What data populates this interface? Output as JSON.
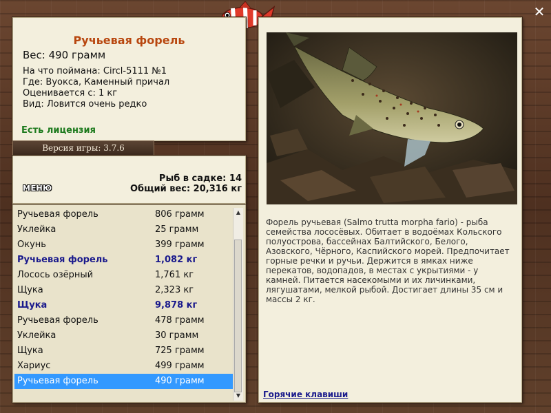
{
  "fish": {
    "name": "Ручьевая форель",
    "weight": "Вес: 490 грамм",
    "caught_with": "На что поймана: Circl-5111 №1",
    "location": "Где: Вуокса, Каменный причал",
    "rated_from": "Оценивается с: 1 кг",
    "kind": "Вид: Ловится очень редко",
    "license": "Есть лицензия"
  },
  "version": "Версия игры: 3.7.6",
  "stats": {
    "menu_label": "МЕНЮ",
    "cage_count": "Рыб в садке: 14",
    "total_weight": "Общий вес: 20,316 кг"
  },
  "catch_list": [
    {
      "name": "Ручьевая форель",
      "weight": "806 грамм",
      "style": ""
    },
    {
      "name": "Уклейка",
      "weight": "25 грамм",
      "style": ""
    },
    {
      "name": "Окунь",
      "weight": "399 грамм",
      "style": ""
    },
    {
      "name": "Ручьевая форель",
      "weight": "1,082 кг",
      "style": "big"
    },
    {
      "name": "Лосось озёрный",
      "weight": "1,761 кг",
      "style": ""
    },
    {
      "name": "Щука",
      "weight": "2,323 кг",
      "style": ""
    },
    {
      "name": "Щука",
      "weight": "9,878 кг",
      "style": "big"
    },
    {
      "name": "Ручьевая форель",
      "weight": "478 грамм",
      "style": ""
    },
    {
      "name": "Уклейка",
      "weight": "30 грамм",
      "style": ""
    },
    {
      "name": "Щука",
      "weight": "725 грамм",
      "style": ""
    },
    {
      "name": "Хариус",
      "weight": "499 грамм",
      "style": ""
    },
    {
      "name": "Ручьевая форель",
      "weight": "490 грамм",
      "style": "selected"
    }
  ],
  "detail": {
    "description": "Форель ручьевая (Salmo trutta morpha fario) - рыба семейства лососёвых. Обитает в водоёмах Кольского полуострова, бассейнах Балтийского, Белого, Азовского, Чёрного, Каспийского морей. Предпочитает горные речки и ручьи. Держится в ямках ниже перекатов, водопадов, в местах с укрытиями - у камней. Питается насекомыми и их личинками, лягушатами, мелкой рыбой. Достигает длины 35 см и массы 2 кг.",
    "hotkeys_label": "Горячие клавиши"
  },
  "icons": {
    "close": "close-icon",
    "logo": "fish-logo-icon",
    "scroll_up": "scroll-up-icon",
    "scroll_down": "scroll-down-icon"
  },
  "colors": {
    "accent_title": "#b8470f",
    "license": "#1d7a1d",
    "big_catch": "#1a1a8c",
    "selection": "#3399ff"
  }
}
